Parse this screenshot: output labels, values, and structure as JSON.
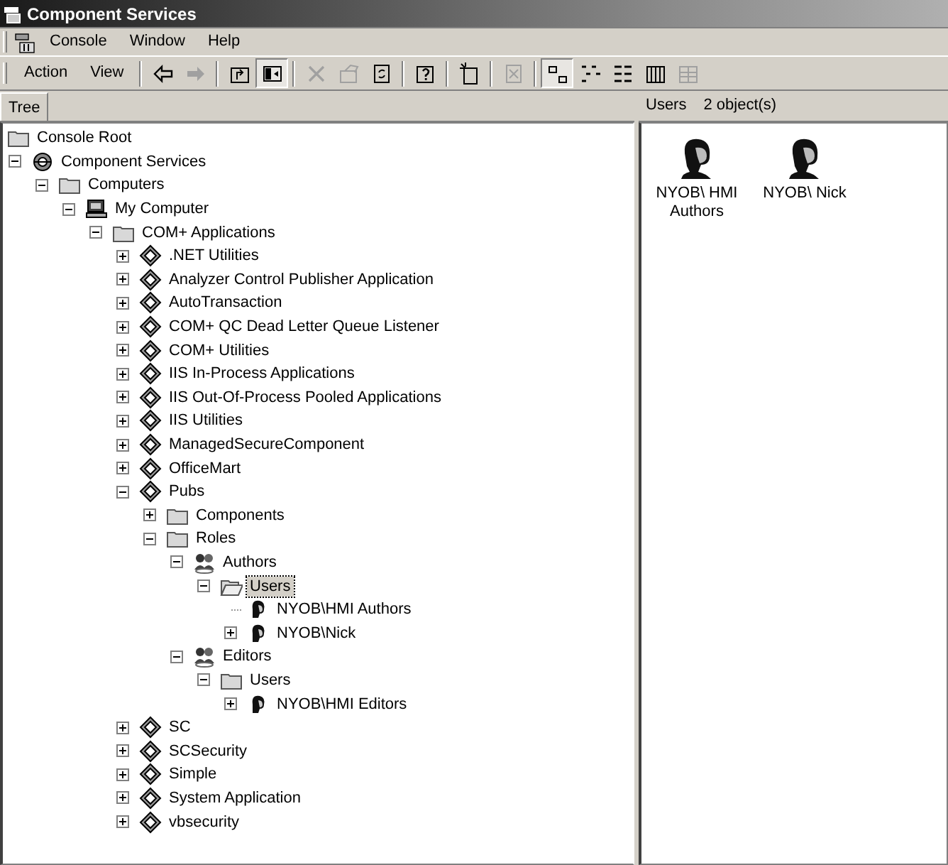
{
  "window": {
    "title": "Component Services"
  },
  "menu": [
    "Console",
    "Window",
    "Help"
  ],
  "action_menu": [
    "Action",
    "View"
  ],
  "toolbar": [
    {
      "kind": "back",
      "disabled": false,
      "pressed": false
    },
    {
      "kind": "forward",
      "disabled": true,
      "pressed": false
    },
    {
      "kind": "sep"
    },
    {
      "kind": "up",
      "disabled": false,
      "pressed": false
    },
    {
      "kind": "tree",
      "disabled": false,
      "pressed": true
    },
    {
      "kind": "sep"
    },
    {
      "kind": "delete",
      "disabled": true,
      "pressed": false
    },
    {
      "kind": "properties",
      "disabled": true,
      "pressed": false
    },
    {
      "kind": "refresh",
      "disabled": false,
      "pressed": false
    },
    {
      "kind": "sep"
    },
    {
      "kind": "help",
      "disabled": false,
      "pressed": false
    },
    {
      "kind": "sep"
    },
    {
      "kind": "newwin",
      "disabled": false,
      "pressed": false
    },
    {
      "kind": "sep"
    },
    {
      "kind": "export",
      "disabled": true,
      "pressed": false
    },
    {
      "kind": "sep"
    },
    {
      "kind": "large",
      "disabled": false,
      "pressed": true
    },
    {
      "kind": "small",
      "disabled": false,
      "pressed": false
    },
    {
      "kind": "list",
      "disabled": false,
      "pressed": false
    },
    {
      "kind": "detail",
      "disabled": false,
      "pressed": false
    },
    {
      "kind": "filter",
      "disabled": true,
      "pressed": false
    }
  ],
  "tree_tab": "Tree",
  "tree": [
    {
      "label": "Console Root",
      "kind": "folder",
      "selected": false,
      "children": [
        {
          "label": "Component Services",
          "kind": "services",
          "expanded": true,
          "selected": false,
          "children": [
            {
              "label": "Computers",
              "kind": "folder",
              "expanded": true,
              "selected": false,
              "children": [
                {
                  "label": "My Computer",
                  "kind": "computer",
                  "expanded": true,
                  "selected": false,
                  "children": [
                    {
                      "label": "COM+ Applications",
                      "kind": "folder",
                      "expanded": true,
                      "selected": false,
                      "children": [
                        {
                          "label": ".NET Utilities",
                          "kind": "app",
                          "expanded": false,
                          "selected": false
                        },
                        {
                          "label": "Analyzer Control Publisher Application",
                          "kind": "app",
                          "expanded": false,
                          "selected": false
                        },
                        {
                          "label": "AutoTransaction",
                          "kind": "app",
                          "expanded": false,
                          "selected": false
                        },
                        {
                          "label": "COM+ QC Dead Letter Queue Listener",
                          "kind": "app",
                          "expanded": false,
                          "selected": false
                        },
                        {
                          "label": "COM+ Utilities",
                          "kind": "app",
                          "expanded": false,
                          "selected": false
                        },
                        {
                          "label": "IIS In-Process Applications",
                          "kind": "app",
                          "expanded": false,
                          "selected": false
                        },
                        {
                          "label": "IIS Out-Of-Process Pooled Applications",
                          "kind": "app",
                          "expanded": false,
                          "selected": false
                        },
                        {
                          "label": "IIS Utilities",
                          "kind": "app",
                          "expanded": false,
                          "selected": false
                        },
                        {
                          "label": "ManagedSecureComponent",
                          "kind": "app",
                          "expanded": false,
                          "selected": false
                        },
                        {
                          "label": "OfficeMart",
                          "kind": "app",
                          "expanded": false,
                          "selected": false
                        },
                        {
                          "label": "Pubs",
                          "kind": "app",
                          "expanded": true,
                          "selected": false,
                          "children": [
                            {
                              "label": "Components",
                              "kind": "folder",
                              "expanded": false,
                              "selected": false
                            },
                            {
                              "label": "Roles",
                              "kind": "folder",
                              "expanded": true,
                              "selected": false,
                              "children": [
                                {
                                  "label": "Authors",
                                  "kind": "role",
                                  "expanded": true,
                                  "selected": false,
                                  "children": [
                                    {
                                      "label": "Users",
                                      "kind": "folder-open",
                                      "expanded": true,
                                      "selected": true,
                                      "children": [
                                        {
                                          "label": "NYOB\\HMI Authors",
                                          "kind": "user",
                                          "selected": false
                                        },
                                        {
                                          "label": "NYOB\\Nick",
                                          "kind": "user",
                                          "expanded": false,
                                          "selected": false
                                        }
                                      ]
                                    }
                                  ]
                                },
                                {
                                  "label": "Editors",
                                  "kind": "role",
                                  "expanded": true,
                                  "selected": false,
                                  "children": [
                                    {
                                      "label": "Users",
                                      "kind": "folder",
                                      "expanded": true,
                                      "selected": false,
                                      "children": [
                                        {
                                          "label": "NYOB\\HMI Editors",
                                          "kind": "user",
                                          "expanded": false,
                                          "selected": false
                                        }
                                      ]
                                    }
                                  ]
                                }
                              ]
                            }
                          ]
                        },
                        {
                          "label": "SC",
                          "kind": "app",
                          "expanded": false,
                          "selected": false
                        },
                        {
                          "label": "SCSecurity",
                          "kind": "app",
                          "expanded": false,
                          "selected": false
                        },
                        {
                          "label": "Simple",
                          "kind": "app",
                          "expanded": false,
                          "selected": false
                        },
                        {
                          "label": "System Application",
                          "kind": "app",
                          "expanded": false,
                          "selected": false
                        },
                        {
                          "label": "vbsecurity",
                          "kind": "app",
                          "expanded": false,
                          "selected": false
                        }
                      ]
                    }
                  ]
                }
              ]
            }
          ]
        }
      ]
    }
  ],
  "list_header": {
    "title": "Users",
    "count": "2 object(s)"
  },
  "list_items": [
    {
      "label": "NYOB\\ HMI Authors"
    },
    {
      "label": "NYOB\\ Nick"
    }
  ]
}
